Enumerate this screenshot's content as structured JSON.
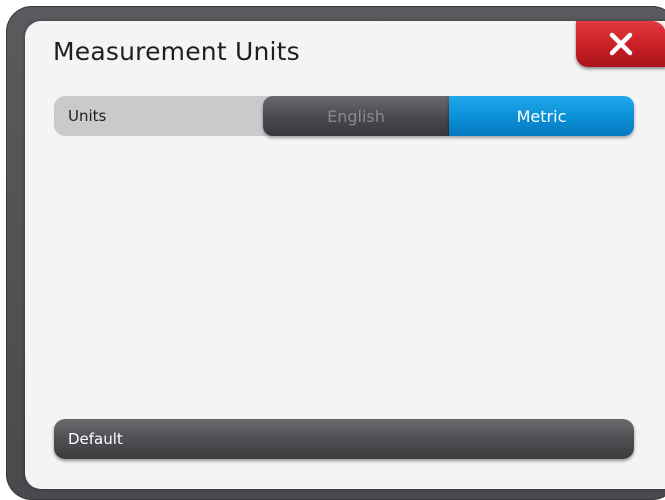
{
  "dialog": {
    "title": "Measurement Units",
    "close_icon": "close-icon"
  },
  "units": {
    "label": "Units",
    "options": [
      "English",
      "Metric"
    ],
    "selected": "Metric"
  },
  "default_button": {
    "label": "Default"
  },
  "colors": {
    "accent": "#0a91d8",
    "close": "#c81e25",
    "segment_dark": "#4c4c50",
    "panel": "#f4f4f4"
  }
}
